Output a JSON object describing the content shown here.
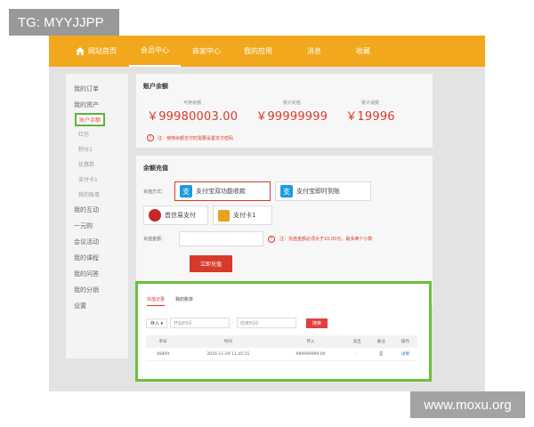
{
  "overlay": {
    "tag": "TG: MYYJJPP",
    "watermark": "www.moxu.org"
  },
  "nav": {
    "home": "网站首页",
    "items": [
      "会员中心",
      "商家中心",
      "我的应用",
      "消息",
      "收藏"
    ]
  },
  "sidebar": {
    "orders": "我的订单",
    "assets": "我的资产",
    "balance": "账户余额",
    "sub": [
      "红包",
      "积分1",
      "优惠券",
      "支付卡1",
      "我的账单"
    ],
    "more": [
      "我的互动",
      "一元购",
      "会议活动",
      "我的课程",
      "我的问答",
      "我的分销",
      "设置"
    ]
  },
  "balance_panel": {
    "title": "账户余额",
    "cols": [
      {
        "label": "可用余额",
        "value": "￥99980003.00"
      },
      {
        "label": "累计充值",
        "value": "￥99999999"
      },
      {
        "label": "累计消费",
        "value": "￥19996"
      }
    ],
    "note": "注：使用余额支付时需要设置支付密码"
  },
  "recharge": {
    "title": "余额充值",
    "method_label": "充值方式：",
    "methods": [
      "支付宝双功能收款",
      "支付宝即时到账",
      "首信易支付",
      "支付卡1"
    ],
    "amount_label": "充值金额：",
    "amount_note": "注：充值金额必须大于10.00元，最多两个小数",
    "submit": "立即充值"
  },
  "records": {
    "tabs": [
      "充值记录",
      "我的账单"
    ],
    "filter_select": "存入",
    "start_placeholder": "开始时间",
    "end_placeholder": "结束时间",
    "search": "搜索",
    "columns": [
      "单号",
      "时间",
      "存入",
      "支出",
      "备注",
      "操作"
    ],
    "rows": [
      {
        "id": "48409",
        "time": "2016-11-29 11:45:15",
        "in": "¥99999999.00",
        "out": "-",
        "note": "是",
        "op": "详情"
      }
    ]
  }
}
